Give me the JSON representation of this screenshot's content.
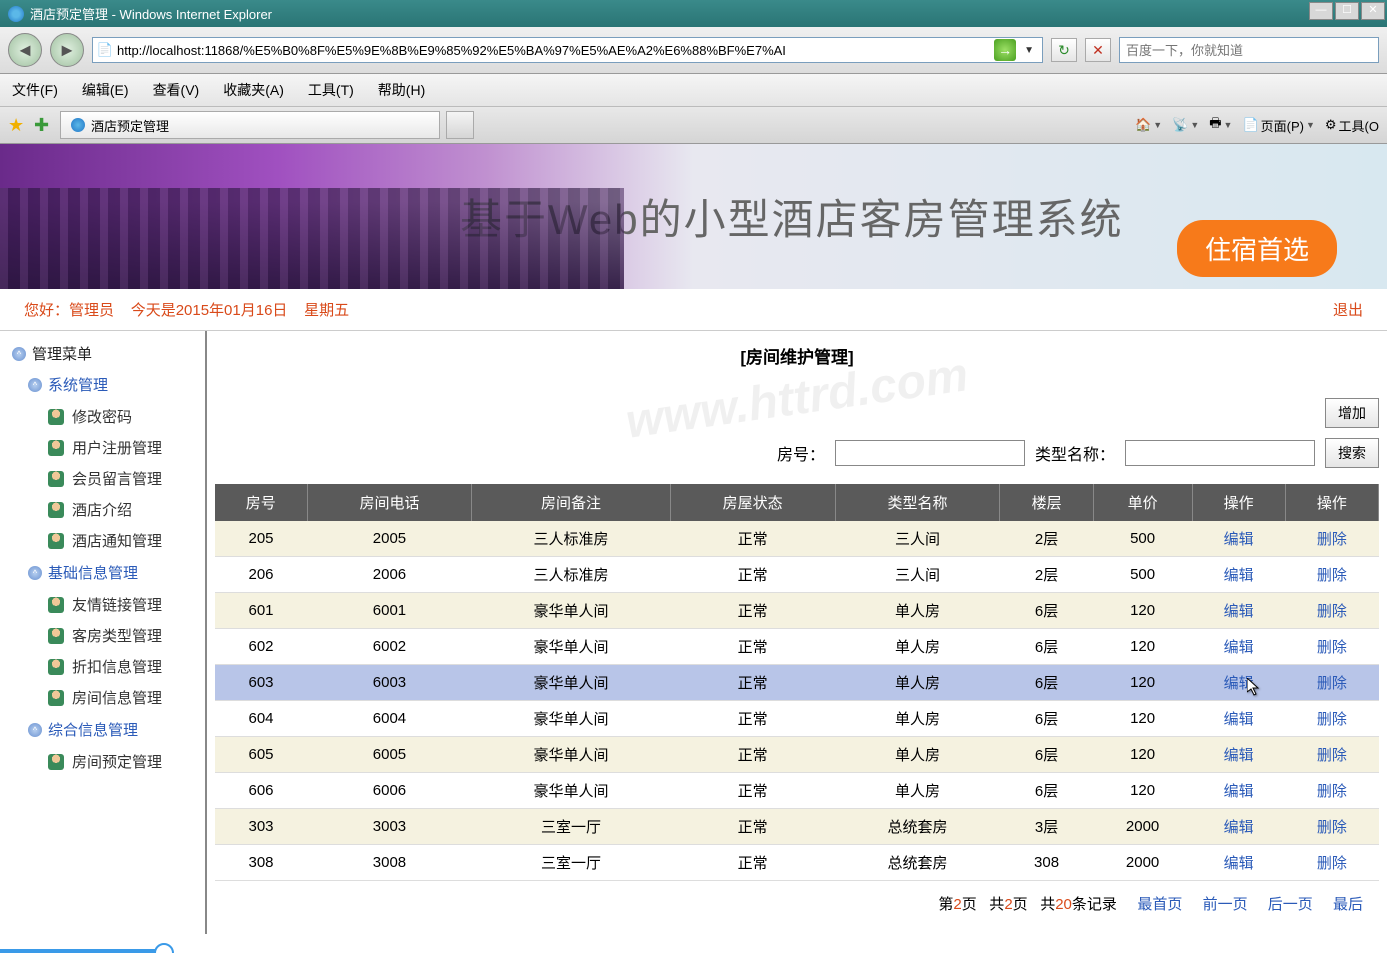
{
  "window": {
    "title": "酒店预定管理 - Windows Internet Explorer",
    "url": "http://localhost:11868/%E5%B0%8F%E5%9E%8B%E9%85%92%E5%BA%97%E5%AE%A2%E6%88%BF%E7%AI",
    "search_placeholder": "百度一下，你就知道"
  },
  "menus": {
    "file": "文件(F)",
    "edit": "编辑(E)",
    "view": "查看(V)",
    "fav": "收藏夹(A)",
    "tools": "工具(T)",
    "help": "帮助(H)"
  },
  "tab": {
    "title": "酒店预定管理"
  },
  "cmdbar": {
    "page": "页面(P)",
    "tools": "工具(O"
  },
  "banner": {
    "title": "基于Web的小型酒店客房管理系统",
    "badge": "住宿首选"
  },
  "infobar": {
    "greeting": "您好：管理员",
    "date": "今天是2015年01月16日",
    "weekday": "星期五",
    "logout": "退出"
  },
  "sidebar": {
    "title": "管理菜单",
    "groups": [
      {
        "label": "系统管理",
        "items": [
          "修改密码",
          "用户注册管理",
          "会员留言管理",
          "酒店介绍",
          "酒店通知管理"
        ]
      },
      {
        "label": "基础信息管理",
        "items": [
          "友情链接管理",
          "客房类型管理",
          "折扣信息管理",
          "房间信息管理"
        ]
      },
      {
        "label": "综合信息管理",
        "items": [
          "房间预定管理"
        ]
      }
    ]
  },
  "content": {
    "title": "[房间维护管理]",
    "watermark": "www.httrd.com",
    "add_btn": "增加",
    "search": {
      "label1": "房号：",
      "label2": "类型名称：",
      "btn": "搜索"
    },
    "columns": [
      "房号",
      "房间电话",
      "房间备注",
      "房屋状态",
      "类型名称",
      "楼层",
      "单价",
      "操作",
      "操作"
    ],
    "rows": [
      [
        "205",
        "2005",
        "三人标准房",
        "正常",
        "三人间",
        "2层",
        "500"
      ],
      [
        "206",
        "2006",
        "三人标准房",
        "正常",
        "三人间",
        "2层",
        "500"
      ],
      [
        "601",
        "6001",
        "豪华单人间",
        "正常",
        "单人房",
        "6层",
        "120"
      ],
      [
        "602",
        "6002",
        "豪华单人间",
        "正常",
        "单人房",
        "6层",
        "120"
      ],
      [
        "603",
        "6003",
        "豪华单人间",
        "正常",
        "单人房",
        "6层",
        "120"
      ],
      [
        "604",
        "6004",
        "豪华单人间",
        "正常",
        "单人房",
        "6层",
        "120"
      ],
      [
        "605",
        "6005",
        "豪华单人间",
        "正常",
        "单人房",
        "6层",
        "120"
      ],
      [
        "606",
        "6006",
        "豪华单人间",
        "正常",
        "单人房",
        "6层",
        "120"
      ],
      [
        "303",
        "3003",
        "三室一厅",
        "正常",
        "总统套房",
        "3层",
        "2000"
      ],
      [
        "308",
        "3008",
        "三室一厅",
        "正常",
        "总统套房",
        "308",
        "2000"
      ]
    ],
    "edit": "编辑",
    "delete": "删除",
    "hover_row": 4
  },
  "pager": {
    "p1a": "第",
    "p1b": "页",
    "p1v": "2",
    "p2a": "共",
    "p2b": "页",
    "p2v": "2",
    "p3a": "共",
    "p3b": "条记录",
    "p3v": "20",
    "first": "最首页",
    "prev": "前一页",
    "next": "后一页",
    "last": "最后"
  }
}
